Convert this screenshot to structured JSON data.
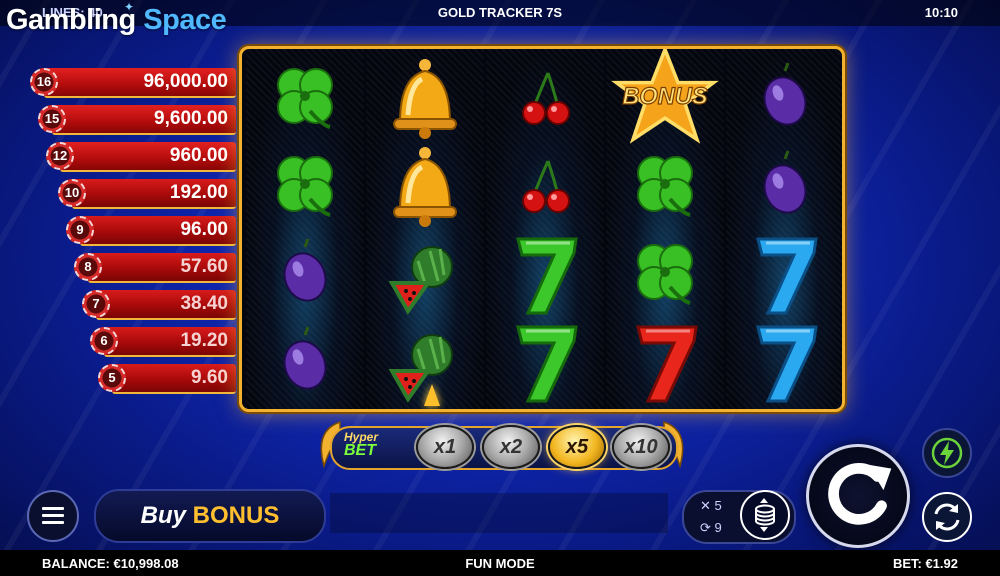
{
  "header": {
    "logo_word1": "Gambling",
    "logo_word2": "Space",
    "lines_label": "LINES: 40",
    "game_title": "GOLD TRACKER 7S",
    "clock": "10:10"
  },
  "paytable": [
    {
      "count": "16",
      "value": "96,000.00"
    },
    {
      "count": "15",
      "value": "9,600.00"
    },
    {
      "count": "12",
      "value": "960.00"
    },
    {
      "count": "10",
      "value": "192.00"
    },
    {
      "count": "9",
      "value": "96.00"
    },
    {
      "count": "8",
      "value": "57.60"
    },
    {
      "count": "7",
      "value": "38.40"
    },
    {
      "count": "6",
      "value": "19.20"
    },
    {
      "count": "5",
      "value": "9.60"
    }
  ],
  "reels": [
    [
      "clover",
      "clover",
      "plum",
      "plum"
    ],
    [
      "bell",
      "bell",
      "watermelon",
      "watermelon"
    ],
    [
      "cherry",
      "cherry",
      "seven-green",
      "seven-green"
    ],
    [
      "bonus-star",
      "clover",
      "clover",
      "seven-red"
    ],
    [
      "plum",
      "plum",
      "seven-blue",
      "seven-blue"
    ]
  ],
  "bonus_text": "BONUS",
  "hyper_bet": {
    "label_line1": "Hyper",
    "label_line2": "BET",
    "multipliers": [
      "x1",
      "x2",
      "x5",
      "x10"
    ],
    "active": "x5"
  },
  "controls": {
    "buy_word1": "Buy",
    "buy_word2": "BONUS",
    "autoplay_count": "5",
    "autoplay_rounds": "9"
  },
  "status": {
    "balance": "BALANCE: €10,998.08",
    "mode": "FUN MODE",
    "bet": "BET: €1.92"
  },
  "colors": {
    "accent_gold": "#f2b12e",
    "brand_blue": "#4fb8ff",
    "paytable_red": "#c11414"
  }
}
